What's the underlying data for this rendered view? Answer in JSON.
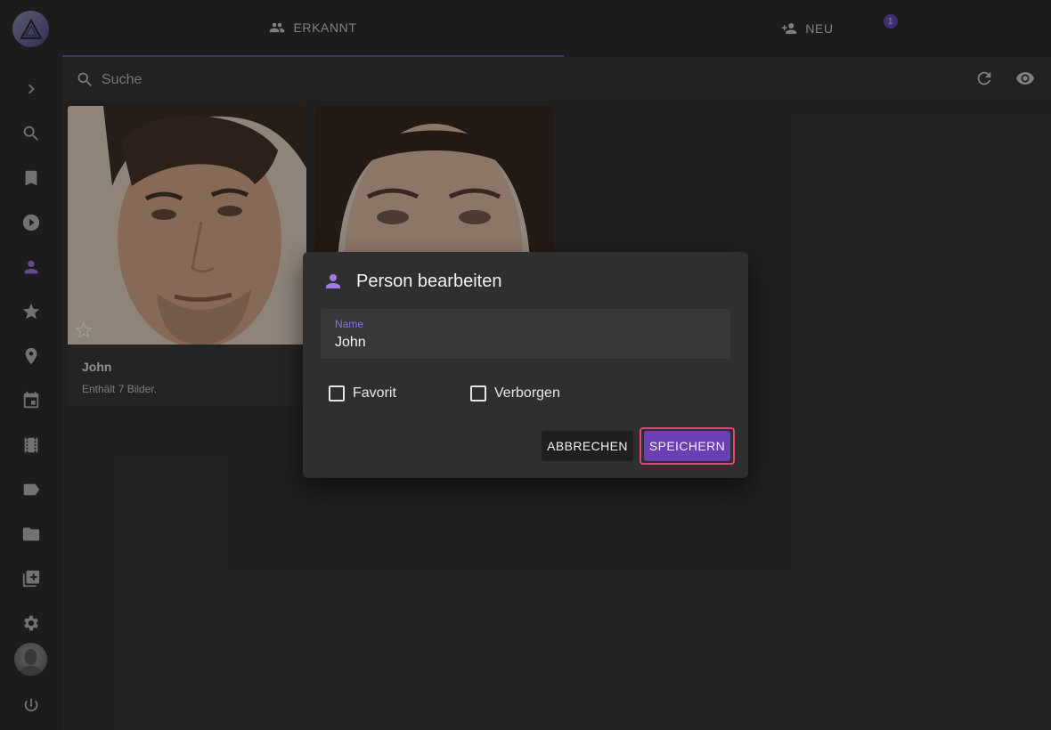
{
  "tabs": {
    "recognized": {
      "label": "ERKANNT",
      "icon": "people-icon"
    },
    "new": {
      "label": "NEU",
      "icon": "person-add-icon",
      "badge": "1"
    }
  },
  "toolbar": {
    "search_placeholder": "Suche",
    "icons": [
      "search-icon",
      "refresh-icon",
      "eye-icon"
    ]
  },
  "sidebar": {
    "items": [
      "expand-icon",
      "search-icon",
      "bookmark-icon",
      "play-icon",
      "person-icon",
      "star-icon",
      "location-icon",
      "calendar-icon",
      "film-icon",
      "label-icon",
      "folder-icon",
      "library-icon",
      "settings-icon",
      "logout-icon"
    ],
    "active": "person-icon"
  },
  "cards": [
    {
      "name": "John",
      "count": "Enthält 7 Bilder."
    },
    {
      "name": "",
      "count": ""
    }
  ],
  "dialog": {
    "title": "Person bearbeiten",
    "field_label": "Name",
    "field_value": "John",
    "favorite_label": "Favorit",
    "hidden_label": "Verborgen",
    "cancel_label": "ABBRECHEN",
    "save_label": "SPEICHERN"
  },
  "colors": {
    "accent": "#a27ce6",
    "save_button": "#6a3fb3",
    "highlight_border": "#e0457b"
  }
}
